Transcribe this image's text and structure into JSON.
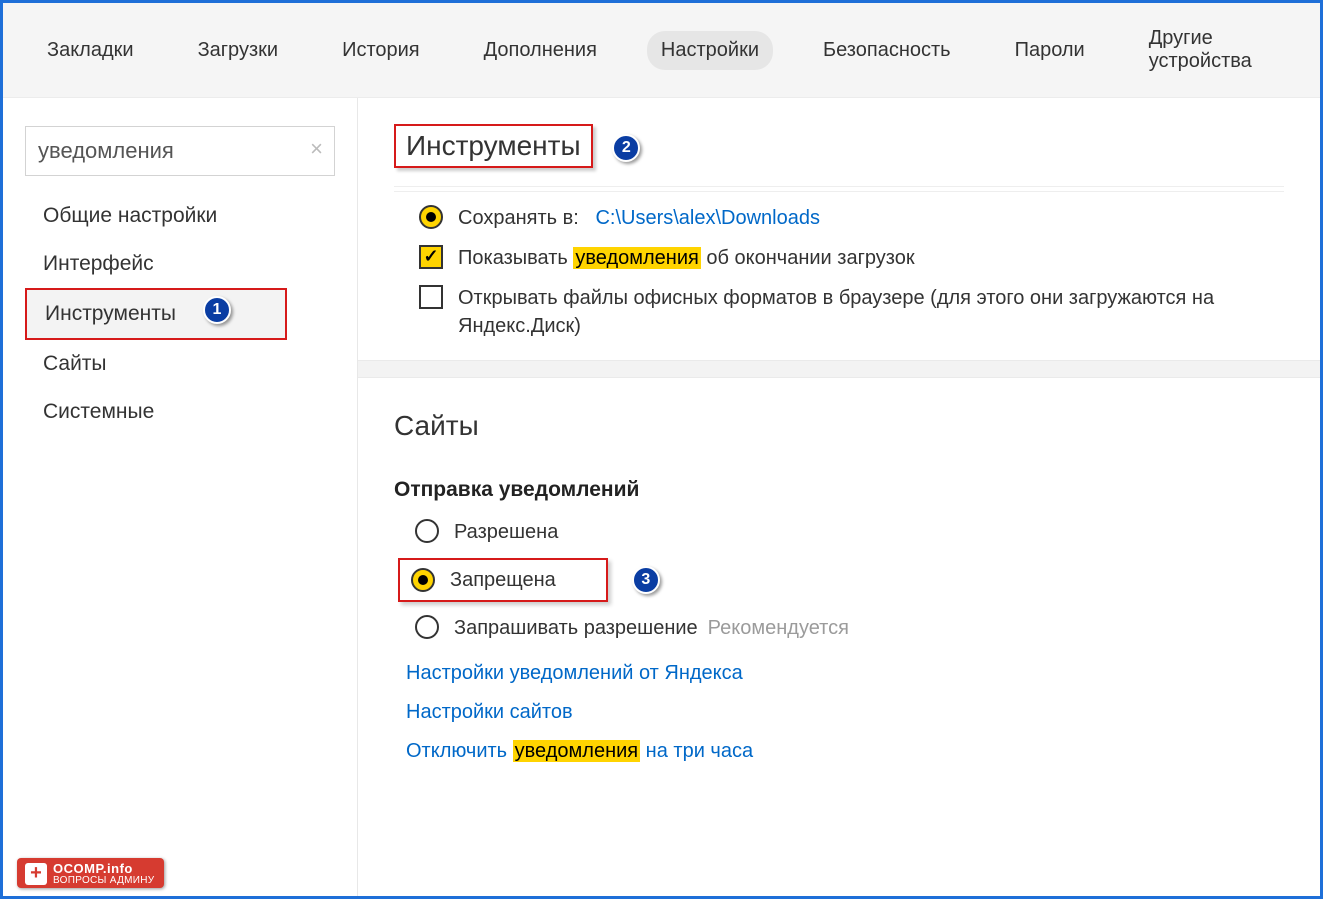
{
  "topnav": {
    "tabs": [
      {
        "label": "Закладки"
      },
      {
        "label": "Загрузки"
      },
      {
        "label": "История"
      },
      {
        "label": "Дополнения"
      },
      {
        "label": "Настройки",
        "active": true
      },
      {
        "label": "Безопасность"
      },
      {
        "label": "Пароли"
      },
      {
        "label": "Другие устройства"
      }
    ]
  },
  "sidebar": {
    "search_value": "уведомления",
    "items": [
      {
        "label": "Общие настройки"
      },
      {
        "label": "Интерфейс"
      },
      {
        "label": "Инструменты",
        "active": true,
        "badge": "1"
      },
      {
        "label": "Сайты"
      },
      {
        "label": "Системные"
      }
    ]
  },
  "tools": {
    "heading": "Инструменты",
    "badge": "2",
    "save_to_label": "Сохранять в:",
    "save_to_path": "C:\\Users\\alex\\Downloads",
    "show_notify_prefix": "Показывать ",
    "show_notify_hl": "уведомления",
    "show_notify_suffix": " об окончании загрузок",
    "open_office": "Открывать файлы офисных форматов в браузере (для этого они загружаются на Яндекс.Диск)"
  },
  "sites": {
    "heading": "Сайты",
    "sub": "Отправка уведомлений",
    "opt_allowed": "Разрешена",
    "opt_denied": "Запрещена",
    "opt_denied_badge": "3",
    "opt_ask": "Запрашивать разрешение",
    "opt_ask_hint": "Рекомендуется",
    "link1": "Настройки уведомлений от Яндекса",
    "link2": "Настройки сайтов",
    "link3_prefix": "Отключить ",
    "link3_hl": "уведомления",
    "link3_suffix": " на три часа"
  },
  "watermark": {
    "l1": "OCOMP.info",
    "l2": "ВОПРОСЫ АДМИНУ"
  }
}
